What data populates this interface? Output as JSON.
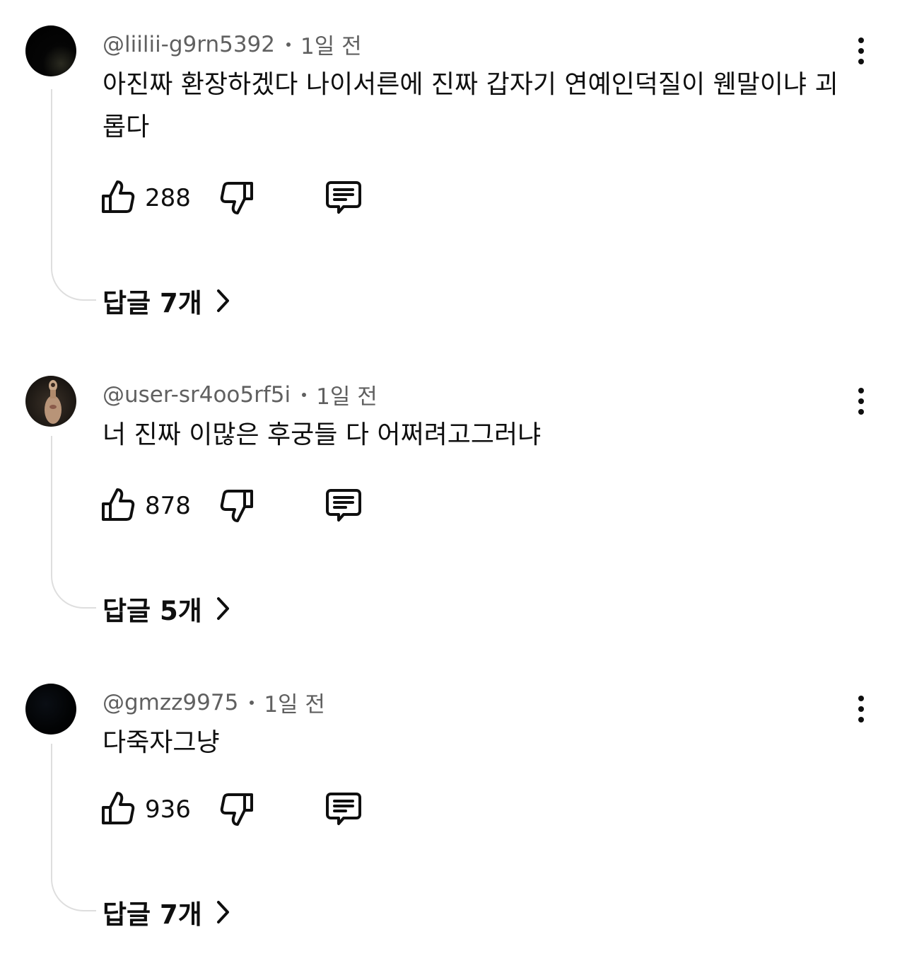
{
  "comments": [
    {
      "author": "@liilii-g9rn5392",
      "time": "1일 전",
      "text": "아진짜 환장하겠다 나이서른에 진짜 갑자기 연예인덕질이 웬말이냐 괴롭다",
      "likes": "288",
      "replies_label": "답글 7개"
    },
    {
      "author": "@user-sr4oo5rf5i",
      "time": "1일 전",
      "text": "너 진짜 이많은 후궁들 다 어쩌려고그러냐",
      "likes": "878",
      "replies_label": "답글 5개"
    },
    {
      "author": "@gmzz9975",
      "time": "1일 전",
      "text": "다죽자그냥",
      "likes": "936",
      "replies_label": "답글 7개"
    }
  ],
  "icons": {
    "like": "thumbs-up-icon",
    "dislike": "thumbs-down-icon",
    "reply": "comment-icon",
    "more": "more-vertical-icon",
    "expand": "chevron-right-icon"
  }
}
